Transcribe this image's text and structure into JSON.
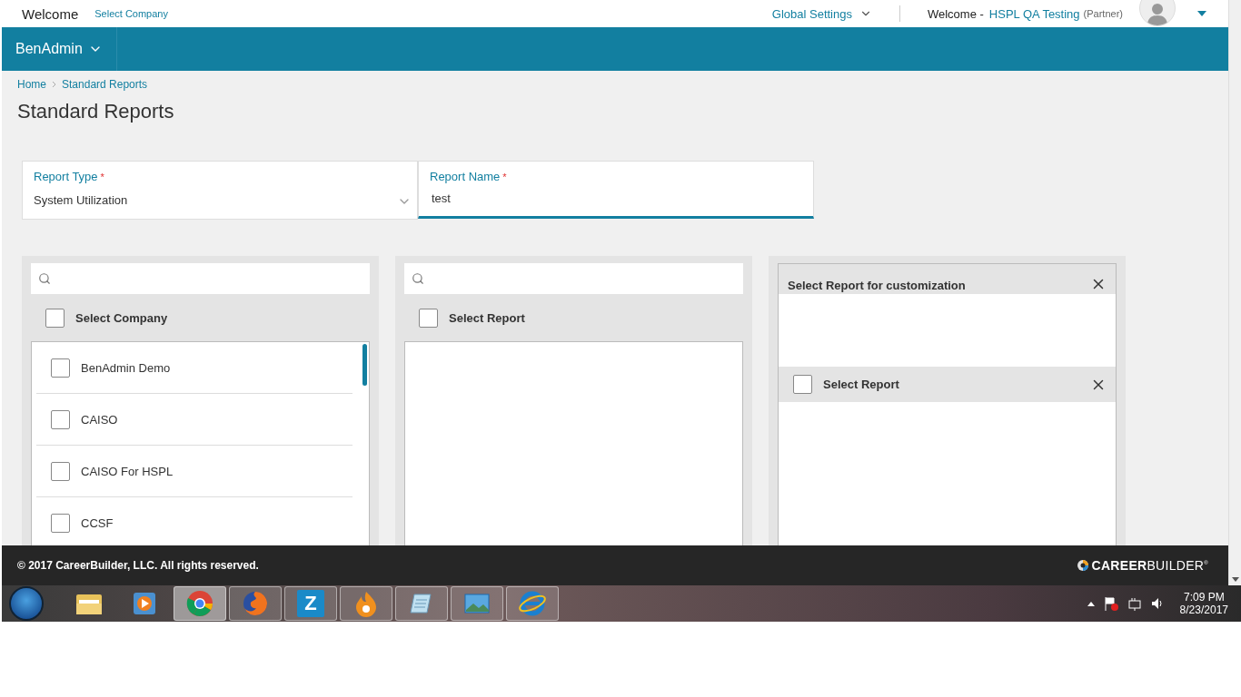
{
  "header": {
    "welcome": "Welcome",
    "select_company": "Select Company",
    "global_settings": "Global Settings",
    "welcome_user": "Welcome -",
    "user": "HSPL QA Testing",
    "role": "(Partner)"
  },
  "nav": {
    "app": "BenAdmin"
  },
  "breadcrumb": [
    "Home",
    "Standard Reports"
  ],
  "title": "Standard Reports",
  "form": [
    {
      "label": "Report Type",
      "required_mark": "*",
      "value": "System Utilization",
      "kind": "select",
      "focused": false
    },
    {
      "label": "Report Name",
      "required_mark": "*",
      "value": "test",
      "kind": "text",
      "focused": true
    }
  ],
  "company_panel": {
    "select_all": {
      "label": "Select Company",
      "checked": false
    },
    "items": [
      {
        "label": "BenAdmin Demo",
        "checked": false
      },
      {
        "label": "CAISO",
        "checked": false
      },
      {
        "label": "CAISO For HSPL",
        "checked": false
      },
      {
        "label": "CCSF",
        "checked": false
      }
    ]
  },
  "report_panel": {
    "select_all": {
      "label": "Select Report",
      "checked": false
    }
  },
  "customization_panel": {
    "title": "Select Report for customization",
    "select_all": {
      "label": "Select Report",
      "checked": false
    }
  },
  "footer": {
    "copyright": "© 2017 CareerBuilder, LLC. All rights reserved.",
    "logo": "**CAREER**BUILDER$^{®}$"
  },
  "taskbar": {
    "apps": [
      {
        "kind": "folder",
        "running": false,
        "selected": false
      },
      {
        "kind": "media",
        "running": false,
        "selected": false
      },
      {
        "kind": "chrome",
        "running": true,
        "selected": true
      },
      {
        "kind": "firefox",
        "running": true,
        "selected": false
      },
      {
        "kind": "z",
        "label": "Z",
        "running": true,
        "selected": false
      },
      {
        "kind": "flame",
        "running": true,
        "selected": false
      },
      {
        "kind": "notepad",
        "running": true,
        "selected": false
      },
      {
        "kind": "photo",
        "running": true,
        "selected": false
      },
      {
        "kind": "ie",
        "running": true,
        "selected": false
      }
    ],
    "time": "7:09 PM",
    "date": "8/23/2017"
  }
}
